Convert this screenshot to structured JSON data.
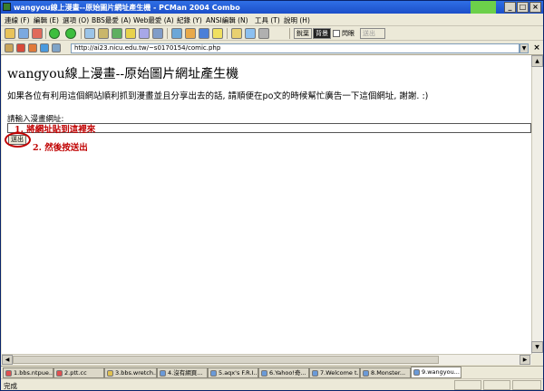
{
  "window": {
    "title": "wangyou線上漫畫--原始圖片網址產生機 - PCMan 2004 Combo",
    "controls": {
      "minimize": "_",
      "maximize": "□",
      "close": "×"
    }
  },
  "menu": [
    "連線 (F)",
    "編輯 (E)",
    "選項 (O)",
    "BBS最愛 (A)",
    "Web最愛 (A)",
    "紀錄 (Y)",
    "ANSI編輯 (N)",
    "工具 (T)",
    "說明 (H)"
  ],
  "toolbar": {
    "text_btn_1": "銳葉",
    "text_btn_2": "背景",
    "checkbox_label": "閃眼",
    "disabled_btn": "送出"
  },
  "address": {
    "url": "http://ai23.nicu.edu.tw/~s0170154/comic.php"
  },
  "page": {
    "title": "wangyou線上漫畫--原始圖片網址產生機",
    "description": "如果各位有利用這個網站順利抓到漫畫並且分享出去的話, 請順便在po文的時候幫忙廣告一下這個網址, 謝謝. :)",
    "input_label": "請輸入漫畫網址:",
    "note1": "1. 將網址貼到這裡來",
    "send_button": "送出",
    "note2": "2. 然後按送出"
  },
  "tabs": [
    {
      "label": "1.bbs.ntpue..."
    },
    {
      "label": "2.ptt.cc"
    },
    {
      "label": "3.bbs.wretch..."
    },
    {
      "label": "4.沒有網頁..."
    },
    {
      "label": "5.aqx's F.R.I..."
    },
    {
      "label": "6.Yahoo!奇..."
    },
    {
      "label": "7.Welcome t..."
    },
    {
      "label": "8.Monster..."
    },
    {
      "label": "9.wangyou..."
    }
  ],
  "status": {
    "text": "完成"
  },
  "colors": {
    "annotation": "#C00000",
    "titlebar": "#2F6FE6"
  }
}
